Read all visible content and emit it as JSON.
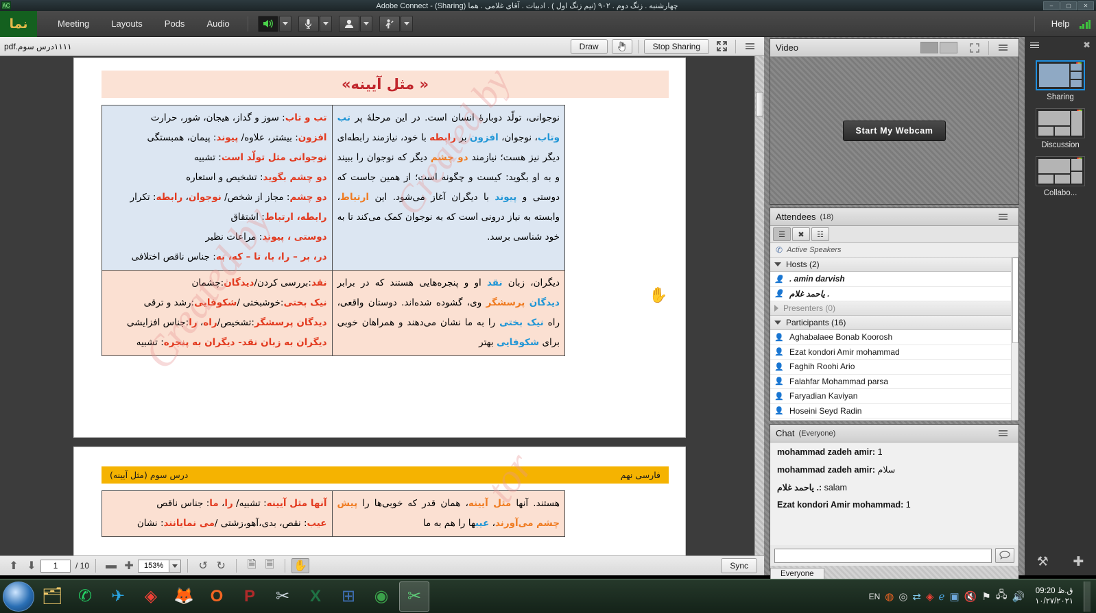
{
  "window": {
    "title": "چهارشنبه . زنگ دوم . ۹۰۲ (نیم زنگ اول ) . ادبیات . آقای غلامی . هما (Sharing) - Adobe Connect",
    "minimize": "–",
    "maximize": "▢",
    "close": "✕"
  },
  "menubar": {
    "logo": "نما",
    "items": [
      "Meeting",
      "Layouts",
      "Pods",
      "Audio"
    ],
    "help": "Help",
    "av": [
      {
        "name": "speaker-button",
        "glyph": "🔊",
        "active": true
      },
      {
        "name": "microphone-button",
        "glyph": "🎤",
        "active": false
      },
      {
        "name": "camera-button",
        "glyph": "👤",
        "active": false
      },
      {
        "name": "raise-hand-button",
        "glyph": "🙋",
        "active": false
      }
    ]
  },
  "share_pod": {
    "file_name": "۱۱۱۱درس سوم.pdf",
    "draw_label": "Draw",
    "pointer_icon": "pointer-icon",
    "stop_sharing_label": "Stop Sharing",
    "fullscreen_icon": "fullscreen-icon",
    "menu_icon": "pod-menu-icon"
  },
  "document": {
    "page1": {
      "title": "« مثل آیینه»",
      "rows": [
        {
          "shade": "blue",
          "right": "نوجوانی، تولّد دوبارهٔ انسان است. در این مرحلهٔ پر <bl>تب وتاب</bl>، نوجوان، <bl>افزون</bl> بر <rd>رابطه</rd> با خود، نیازمند رابطه‌ای دیگر نیز هست؛ نیازمند <or>دو چشم</or> دیگر که نوجوان را ببیند و به او بگوید: کیست و چگونه است؛ از همین جاست که دوستی و <bl>پیوند</bl> با دیگران آغاز می‌شود. این <or>ارتباط</or>، وابسته به نیاز درونی است که به نوجوان کمک می‌کند تا به خود شناسی برسد.",
          "left": "<rd>تب و تاب</rd>: سوز و گداز، هیجان، شور، حرارت<br><rd>افزون</rd>: بیشتر، علاوه/ <rd>پیوند</rd>: پیمان، همبستگی<br><rd>نوجوانی مثل تولّد است</rd>: تشبیه<br><rd>دو چشم بگوید</rd>: تشخیص و استعاره<br><rd>دو چشم</rd>: مجاز از شخص/ <rd>نوجوان</rd>، <rd>رابطه</rd>: تکرار<br><rd>رابطه، ارتباط</rd>: اشتقاق<br><rd>دوستی ، پیوند</rd>: مراعات نظیر<br><rd>در، بر – را، با، تا – که، به</rd>: جناس ناقص اختلافی"
        },
        {
          "shade": "peach",
          "right": "دیگران، زبان <bl>نقد</bl> او و پنجره‌هایی هستند که در برابر <bl>دیدگان</bl> <or>پرسشگر</or> وی، گشوده شده‌اند. دوستان واقعی، راه <bl>نیک بختی</bl> را به ما نشان می‌دهند و همراهان خوبی برای <bl>شکوفایی</bl> بهتر",
          "left": "<rd>نقد</rd>:بررسی کردن/<rd>دیدگان</rd>:چشمان<br><rd>نیک بختی</rd>:خوشبختی /<rd>شکوفایی</rd>:رشد و ترقی<br><rd>دیدگان پرسشگر</rd>:تشخیص/<rd>راه</rd>، <rd>را</rd>:جناس افزایشی<br><rd>دیگران به زبان نقد- دیگران به پنجره</rd>: تشبیه"
        }
      ]
    },
    "page2": {
      "band_right": "فارسی نهم",
      "band_left": "درس سوم (مثل آیینه)",
      "rows": [
        {
          "shade": "peach",
          "right": "هستند. آنها <or>مثل آیینه</or>، همان قدر که خوبی‌ها را <or>پیش چشم</or> <or>می‌آورند</or>، <bl>عیب</bl>ها را هم به ما",
          "left": "<rd>آنها مثل آیینه</rd>: تشبیه/ <rd>را</rd>، <rd>ما</rd>: جناس ناقص<br><rd>عیب</rd>: نقص، بدی،آهو،زشتی /<rd>می نمایانند</rd>: نشان"
        }
      ]
    },
    "footer": {
      "up_icon": "page-up-icon",
      "down_icon": "page-down-icon",
      "page_current": "1",
      "page_total": "/ 10",
      "zoom_out_icon": "zoom-out-icon",
      "zoom_in_icon": "zoom-in-icon",
      "zoom_value": "153%",
      "undo_icon": "undo-icon",
      "redo_icon": "redo-icon",
      "fit_page_icon": "fit-page-icon",
      "fit_width_icon": "fit-width-icon",
      "pan_icon": "pan-hand-icon",
      "sync_label": "Sync"
    }
  },
  "video_pod": {
    "title": "Video",
    "start_webcam_label": "Start My Webcam",
    "grid_icon": "grid-layout-icon",
    "filmstrip_icon": "filmstrip-layout-icon",
    "expand_icon": "expand-icon",
    "menu_icon": "pod-menu-icon"
  },
  "attendees_pod": {
    "title": "Attendees",
    "count": "(18)",
    "view_list_icon": "list-view-icon",
    "view_breakout_icon": "breakout-view-icon",
    "view_status_icon": "status-view-icon",
    "active_speakers_label": "Active Speakers",
    "phone_icon": "phone-icon",
    "groups": [
      {
        "label": "Hosts (2)",
        "expanded": true,
        "members": [
          ". amin darvish",
          "یاحمد غلام ."
        ]
      },
      {
        "label": "Presenters (0)",
        "expanded": false,
        "members": []
      },
      {
        "label": "Participants (16)",
        "expanded": true,
        "members": [
          "Aghabalaee Bonab Koorosh",
          "Ezat kondori Amir mohammad",
          "Faghih Roohi Ario",
          "Falahfar Mohammad parsa",
          "Faryadian Kaviyan",
          "Hoseini Seyd Radin"
        ]
      }
    ]
  },
  "chat_pod": {
    "title": "Chat",
    "scope": "(Everyone)",
    "messages": [
      {
        "sender": "mohammad zadeh amir:",
        "text": "1"
      },
      {
        "sender": "mohammad zadeh amir:",
        "text": "سلام"
      },
      {
        "sender": "یاحمد غلام .:",
        "text": "salam"
      },
      {
        "sender": "Ezat kondori Amir mohammad:",
        "text": "1"
      }
    ],
    "input_placeholder": "",
    "send_icon": "chat-send-icon",
    "tab_label": "Everyone",
    "menu_icon": "pod-menu-icon"
  },
  "layouts_rail": {
    "menu_icon": "rail-menu-icon",
    "close_icon": "close-icon",
    "items": [
      {
        "label": "Sharing",
        "selected": true
      },
      {
        "label": "Discussion",
        "selected": false
      },
      {
        "label": "Collabo...",
        "selected": false
      }
    ],
    "tools_icon": "tools-icon",
    "add_icon": "add-layout-icon"
  },
  "taskbar": {
    "start_icon": "windows-start-icon",
    "apps": [
      {
        "name": "file-explorer-icon",
        "glyph": "🗂"
      },
      {
        "name": "whatsapp-icon",
        "glyph": "✆"
      },
      {
        "name": "telegram-icon",
        "glyph": "✈"
      },
      {
        "name": "anydesk-icon",
        "glyph": "◈"
      },
      {
        "name": "firefox-icon",
        "glyph": "🦊"
      },
      {
        "name": "opera-icon",
        "glyph": "O"
      },
      {
        "name": "paltalk-icon",
        "glyph": "P"
      },
      {
        "name": "snipping-tool-icon",
        "glyph": "✂"
      },
      {
        "name": "excel-icon",
        "glyph": "X"
      },
      {
        "name": "windows-apps-icon",
        "glyph": "⊞"
      },
      {
        "name": "chrome-icon",
        "glyph": "◉"
      },
      {
        "name": "adobe-connect-icon",
        "glyph": "✂"
      }
    ],
    "tray": {
      "language": "EN",
      "icons": [
        "opera-tray-icon",
        "disc-tray-icon",
        "network-tray-icon",
        "anydesk-tray-icon",
        "ie-tray-icon",
        "app-tray-icon",
        "volume-muted-icon",
        "flag-alert-icon",
        "network-tray-icon-2",
        "volume-icon"
      ],
      "time": "09:20 ق.ظ",
      "date": "۱۰/۲۷/۲۰۲۱"
    }
  }
}
